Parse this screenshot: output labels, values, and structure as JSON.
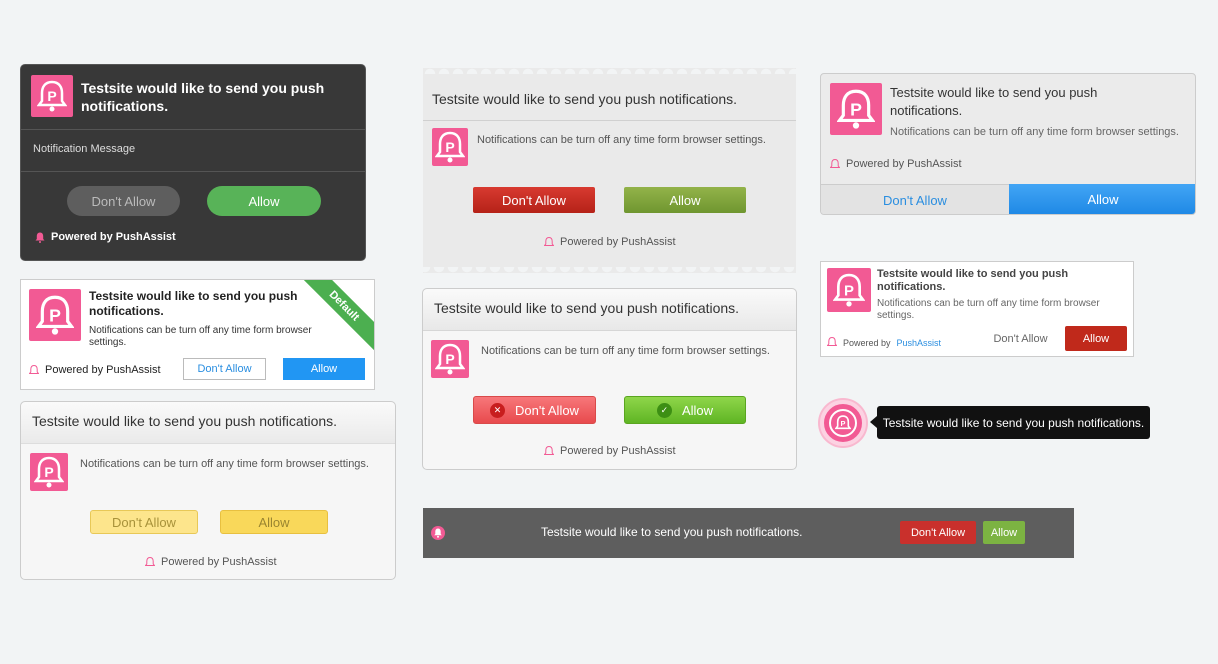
{
  "common": {
    "site_title": "Testsite would like to send you push notifications.",
    "body": "Notifications can be turn off any time form browser settings.",
    "powered": "Powered by PushAssist",
    "powered_prefix": "Powered by",
    "brand": "PushAssist",
    "deny": "Don't Allow",
    "allow": "Allow",
    "icon": "pushassist-bell-logo-icon"
  },
  "card_dark": {
    "title": "Testsite would like to send you push notifications.",
    "message": "Notification Message",
    "deny": "Don't Allow",
    "allow": "Allow",
    "powered": "Powered by PushAssist"
  },
  "card_default": {
    "ribbon": "Default",
    "title": "Testsite would like to send you push notifications.",
    "body": "Notifications can be turn off any time form browser settings.",
    "powered": "Powered by PushAssist",
    "deny": "Don't Allow",
    "allow": "Allow"
  },
  "colors": {
    "brand_pink": "#f25a94",
    "dark_bg": "#383838",
    "green": "#58b358",
    "blue": "#2196f3",
    "red": "#c9302c",
    "yellow": "#f9d85a"
  }
}
